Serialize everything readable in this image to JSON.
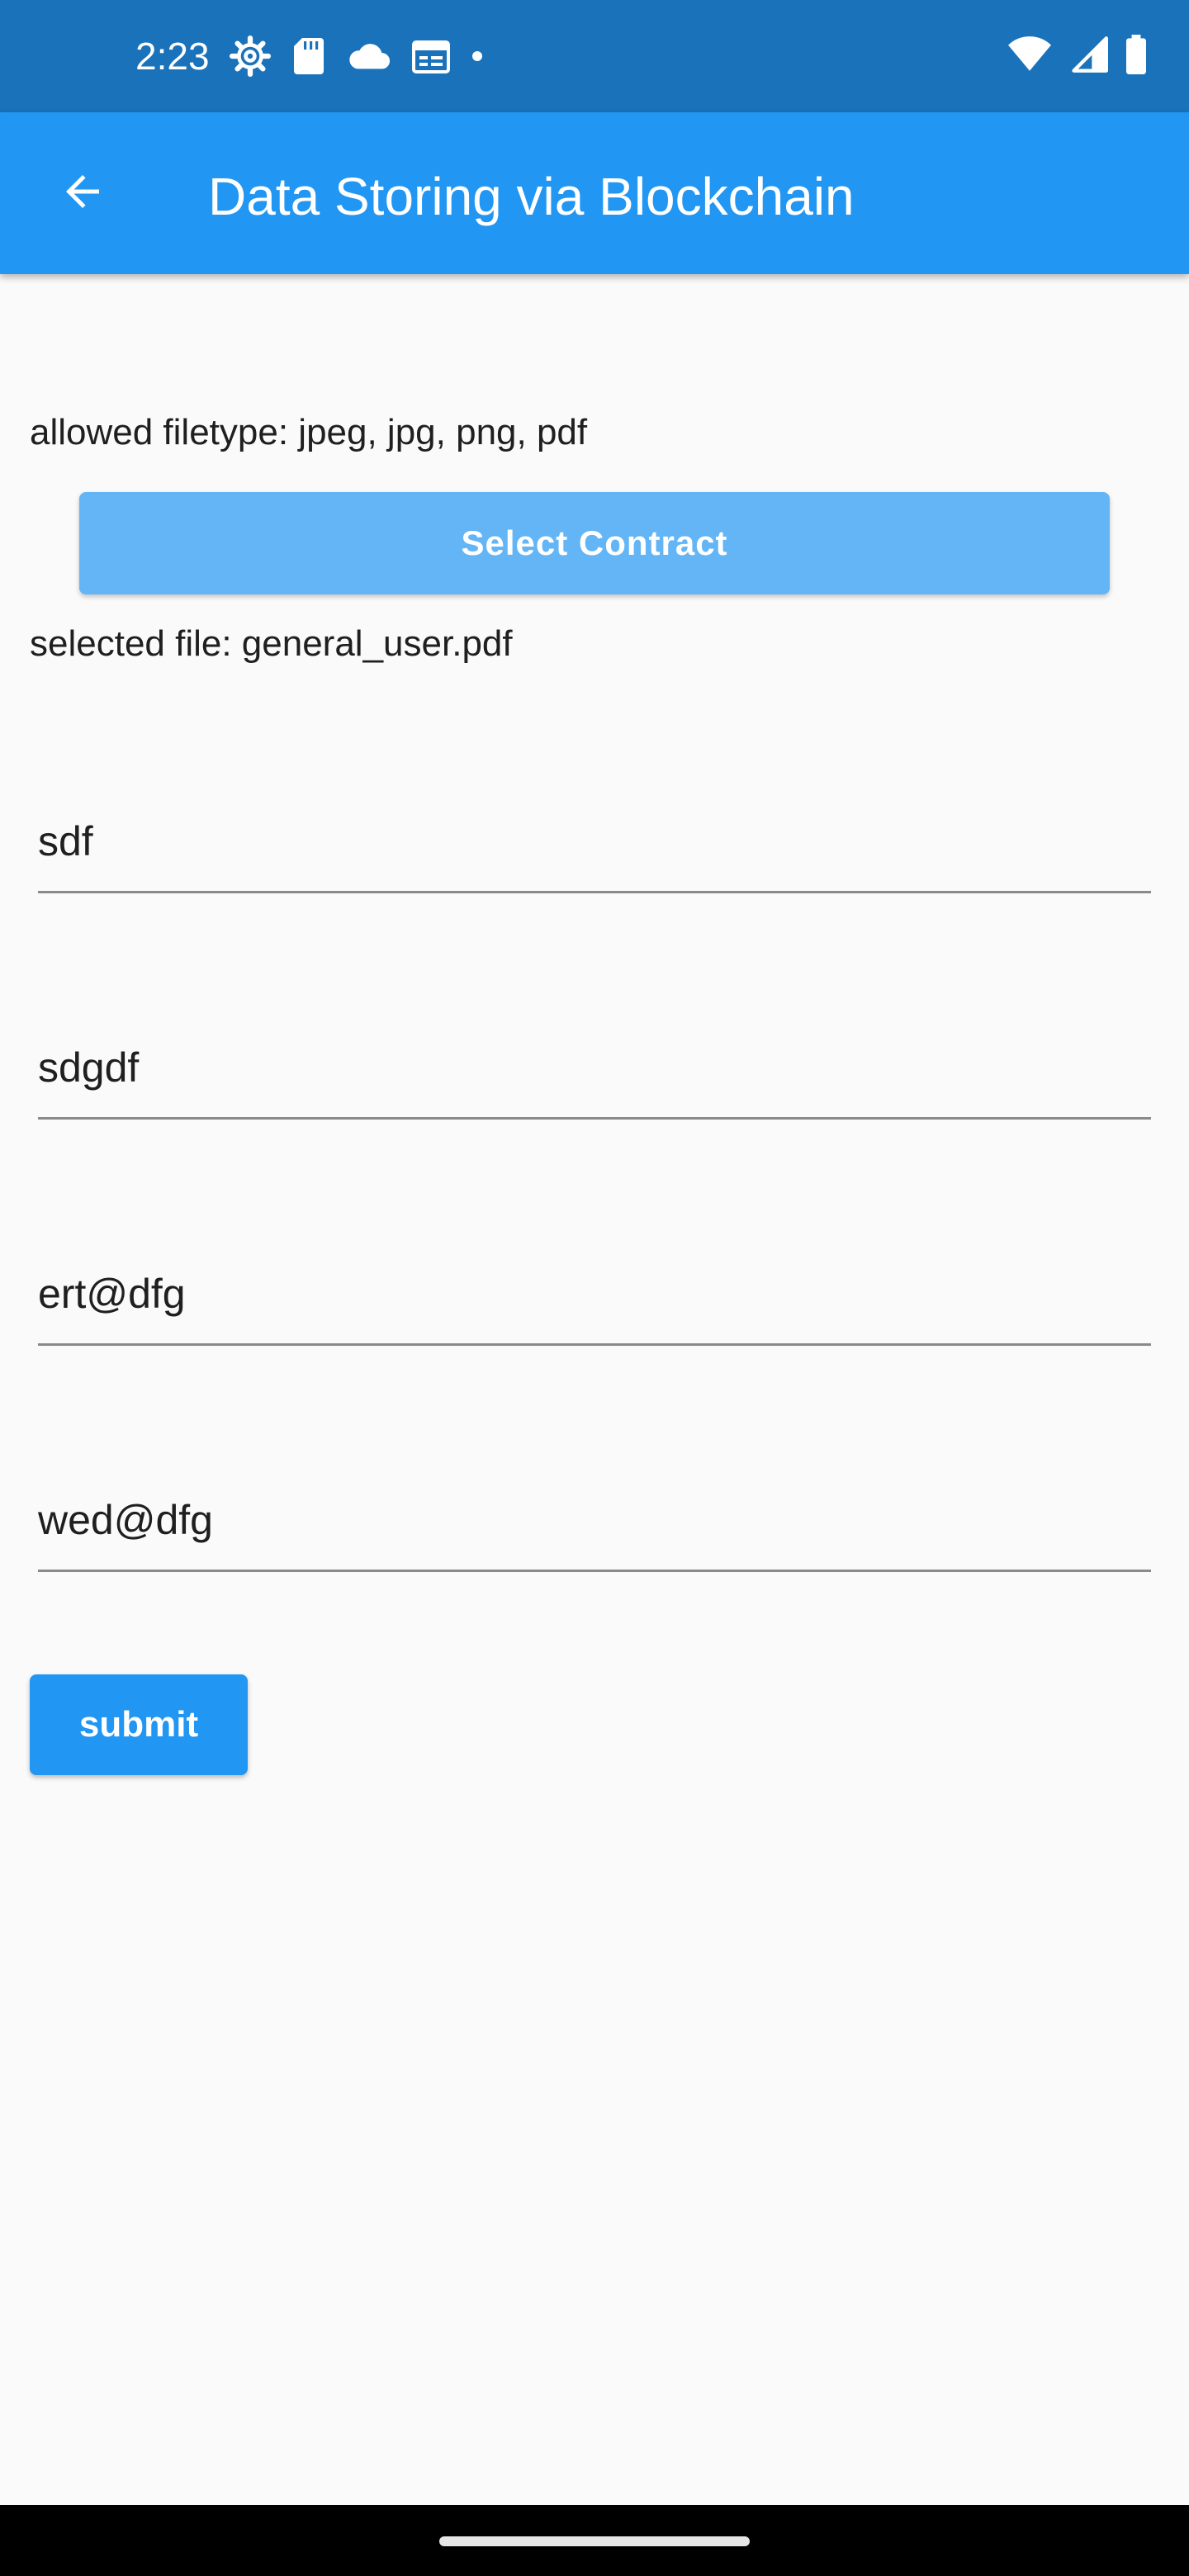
{
  "status_bar": {
    "time": "2:23",
    "left_icons": [
      "settings-gear-icon",
      "sd-card-icon",
      "cloud-icon",
      "calendar-icon",
      "dot-icon"
    ],
    "right_icons": [
      "wifi-icon",
      "cellular-signal-icon",
      "battery-icon"
    ]
  },
  "app_bar": {
    "back_icon": "arrow-back-icon",
    "title": "Data Storing via Blockchain",
    "color": "#2196f3"
  },
  "form": {
    "allowed_filetype_text": "allowed filetype: jpeg, jpg, png, pdf",
    "select_button_label": "Select Contract",
    "selected_file_text": "selected file: general_user.pdf",
    "fields": [
      {
        "value": "sdf"
      },
      {
        "value": "sdgdf"
      },
      {
        "value": "ert@dfg"
      },
      {
        "value": "wed@dfg"
      }
    ],
    "submit_label": "submit"
  },
  "colors": {
    "status_bar": "#1a72bb",
    "primary": "#2196f3",
    "select_button": "#64b5f6",
    "background": "#fafafa"
  }
}
